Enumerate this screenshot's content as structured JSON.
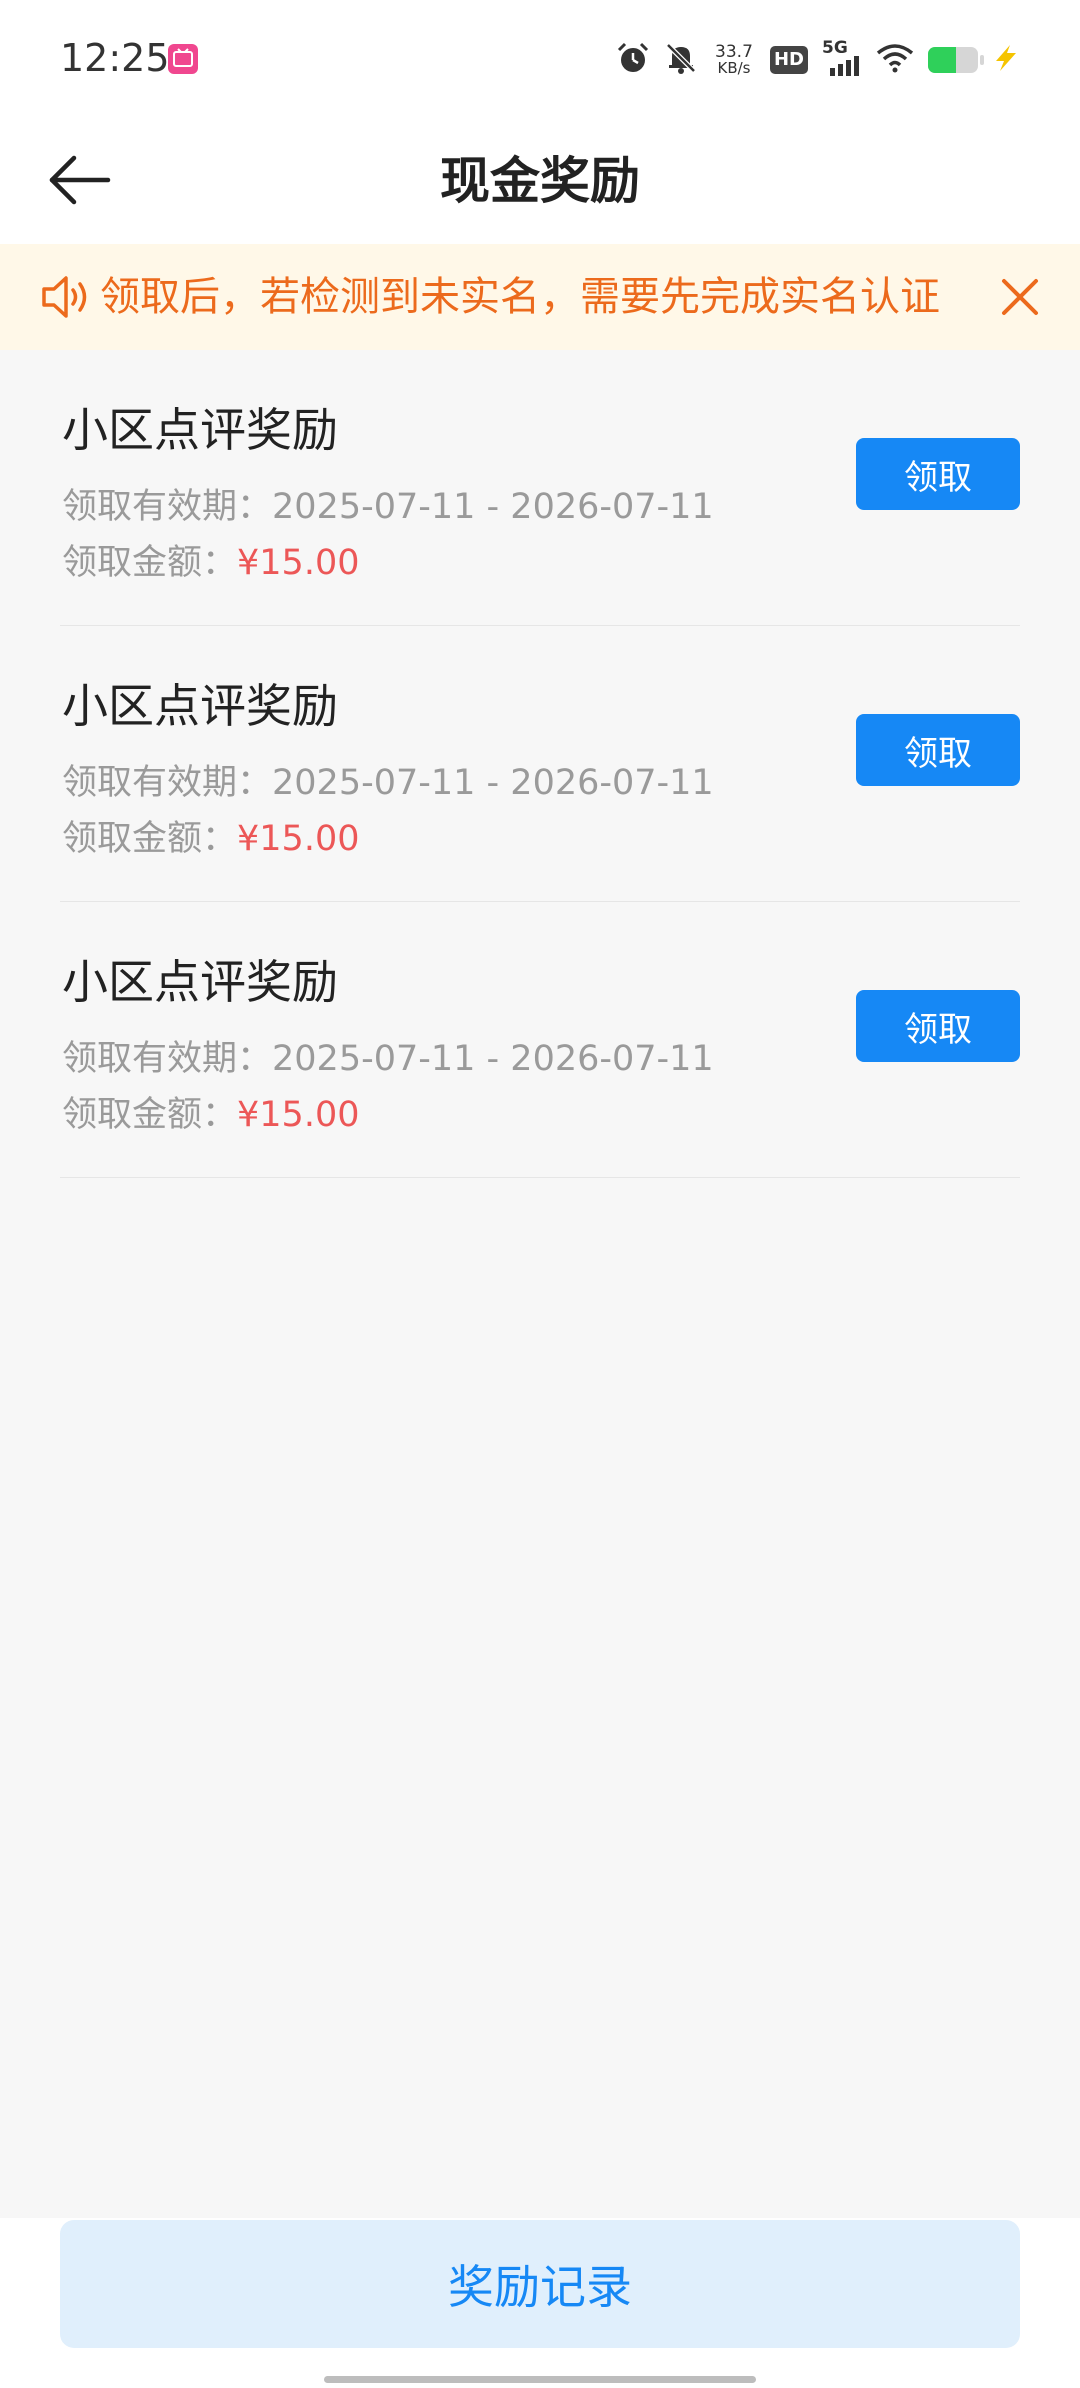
{
  "status_bar": {
    "time": "12:25",
    "net_speed_value": "33.7",
    "net_speed_unit": "KB/s",
    "hd_label": "HD",
    "network_label": "5G",
    "battery_level": 0.55,
    "icons": [
      "alarm-icon",
      "mute-bell-icon",
      "wifi-icon",
      "battery-icon",
      "charging-icon"
    ],
    "colors": {
      "battery_fill": "#2fd05a",
      "charging": "#f5c400",
      "app_badge": "#f0478f"
    }
  },
  "header": {
    "title": "现金奖励",
    "back_icon": "arrow-left-icon"
  },
  "notice": {
    "text": "领取后，若检测到未实名，需要先完成实名认证",
    "icon": "speaker-icon",
    "close_icon": "close-icon",
    "color": "#ec6a1c"
  },
  "rewards": [
    {
      "title": "小区点评奖励",
      "period_label": "领取有效期：",
      "period": "2025-07-11 - 2026-07-11",
      "amount_label": "领取金额：",
      "amount": "¥15.00",
      "button": "领取"
    },
    {
      "title": "小区点评奖励",
      "period_label": "领取有效期：",
      "period": "2025-07-11 - 2026-07-11",
      "amount_label": "领取金额：",
      "amount": "¥15.00",
      "button": "领取"
    },
    {
      "title": "小区点评奖励",
      "period_label": "领取有效期：",
      "period": "2025-07-11 - 2026-07-11",
      "amount_label": "领取金额：",
      "amount": "¥15.00",
      "button": "领取"
    }
  ],
  "footer": {
    "records_button": "奖励记录"
  },
  "theme": {
    "primary": "#1688f5",
    "amount_red": "#ec5757",
    "notice_bg": "#fff8e8",
    "records_bg": "#e0effc"
  }
}
